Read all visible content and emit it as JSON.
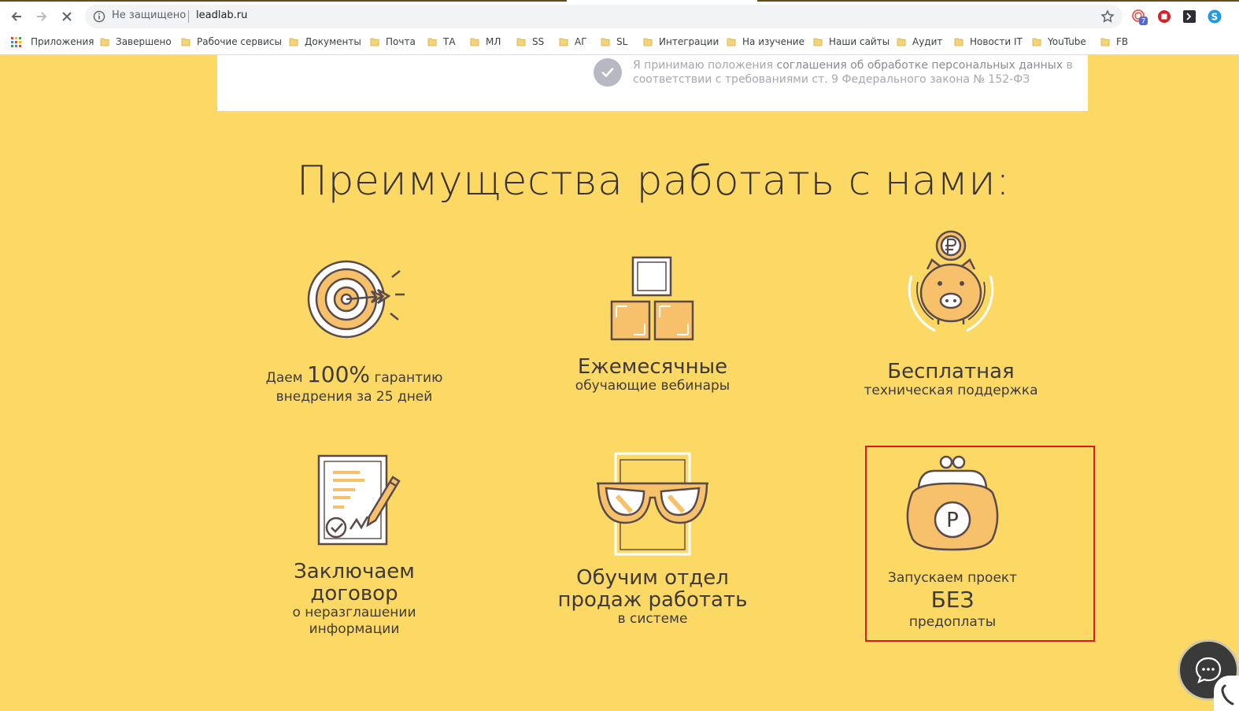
{
  "browser": {
    "security_label": "Не защищено",
    "url": "leadlab.ru",
    "extension_badge": "7",
    "bookmarks": [
      {
        "label": "Приложения",
        "type": "apps"
      },
      {
        "label": "Завершено"
      },
      {
        "label": "Рабочие сервисы"
      },
      {
        "label": "Документы"
      },
      {
        "label": "Почта"
      },
      {
        "label": "ТА"
      },
      {
        "label": "МЛ"
      },
      {
        "label": "SS"
      },
      {
        "label": "АГ"
      },
      {
        "label": "SL"
      },
      {
        "label": "Интеграции"
      },
      {
        "label": "На изучение"
      },
      {
        "label": "Наши сайты"
      },
      {
        "label": "Аудит"
      },
      {
        "label": "Новости IT"
      },
      {
        "label": "YouTube"
      },
      {
        "label": "FB"
      }
    ]
  },
  "consent": {
    "text_prefix": "Я принимаю положения",
    "link_text": "соглашения об обработке персональных данных",
    "text_suffix": " в соответствии с требованиями ст. 9 Федерального закона № 152-ФЗ"
  },
  "section": {
    "title": "Преимущества работать с нами:"
  },
  "benefits": [
    {
      "pre": "Даем ",
      "big": "100%",
      "post": " гарантию",
      "line2": "внедрения за 25 дней"
    },
    {
      "line1": "Ежемесячные",
      "line2": "обучающие вебинары"
    },
    {
      "line1": "Бесплатная",
      "line2": "техническая поддержка"
    },
    {
      "line1a": "Заключаем",
      "line1b": "договор",
      "line2a": "о неразглашении",
      "line2b": "информации"
    },
    {
      "line1a": "Обучим отдел",
      "line1b": "продаж работать",
      "line2": "в системе"
    },
    {
      "pre": "Запускаем проект ",
      "big": "БЕЗ",
      "line2": "предоплаты",
      "coin_letter": "Р"
    }
  ],
  "colors": {
    "page_bg": "#fcd965",
    "icon_fill": "#f7c16b",
    "icon_stroke": "#5a4a4a",
    "highlight": "#e0161b"
  }
}
